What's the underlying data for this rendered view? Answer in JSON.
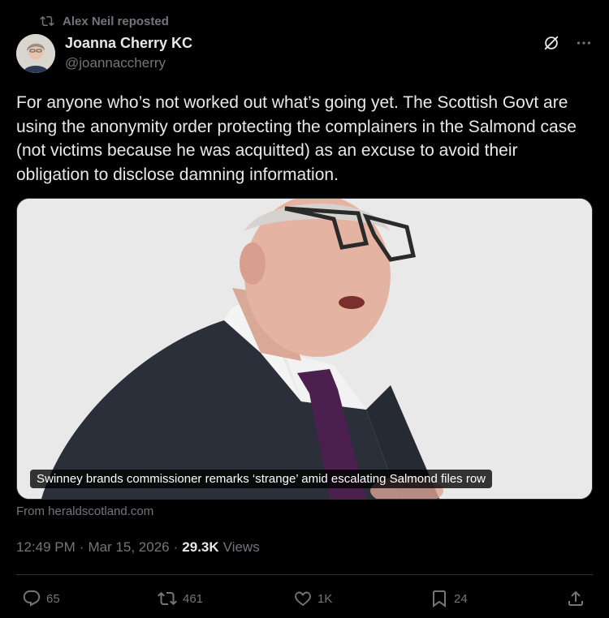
{
  "repost": {
    "label": "Alex Neil reposted",
    "icon": "repost-icon"
  },
  "author": {
    "name": "Joanna Cherry KC",
    "handle": "@joannaccherry"
  },
  "tweet": {
    "text": "For anyone who’s not worked out what’s going yet. The Scottish Govt are using the anonymity order protecting the complainers in the Salmond case (not victims because he was acquitted) as an excuse to avoid their obligation to disclose damning information."
  },
  "card": {
    "caption": "Swinney brands commissioner remarks ‘strange’ amid escalating Salmond files row",
    "source": "From heraldscotland.com"
  },
  "meta": {
    "time": "12:49 PM",
    "separator1": "·",
    "date": "Mar 15, 2026",
    "separator2": "·",
    "views_count": "29.3K",
    "views_label": "Views"
  },
  "stats": {
    "replies": "65",
    "reposts": "461",
    "likes": "1K",
    "bookmarks": "24"
  },
  "colors": {
    "background": "#000000",
    "text": "#e7e9ea",
    "muted": "#71767b",
    "border": "#2f3336"
  }
}
